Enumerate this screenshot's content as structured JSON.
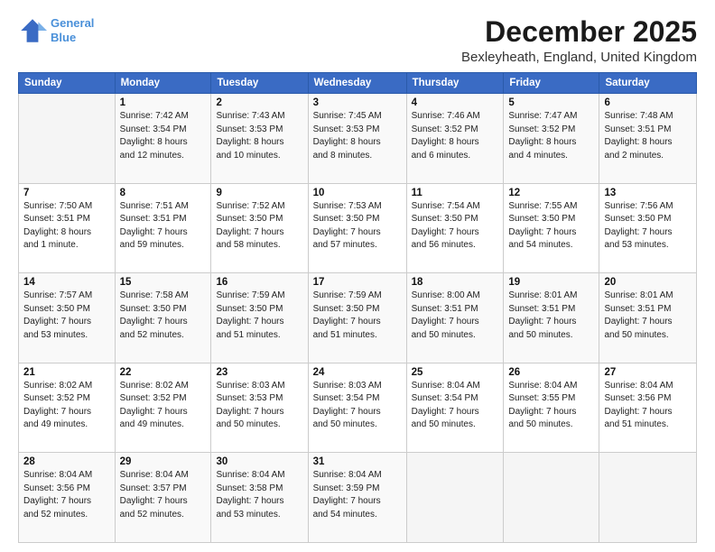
{
  "logo": {
    "line1": "General",
    "line2": "Blue"
  },
  "title": "December 2025",
  "location": "Bexleyheath, England, United Kingdom",
  "weekdays": [
    "Sunday",
    "Monday",
    "Tuesday",
    "Wednesday",
    "Thursday",
    "Friday",
    "Saturday"
  ],
  "weeks": [
    [
      {
        "day": "",
        "info": ""
      },
      {
        "day": "1",
        "info": "Sunrise: 7:42 AM\nSunset: 3:54 PM\nDaylight: 8 hours\nand 12 minutes."
      },
      {
        "day": "2",
        "info": "Sunrise: 7:43 AM\nSunset: 3:53 PM\nDaylight: 8 hours\nand 10 minutes."
      },
      {
        "day": "3",
        "info": "Sunrise: 7:45 AM\nSunset: 3:53 PM\nDaylight: 8 hours\nand 8 minutes."
      },
      {
        "day": "4",
        "info": "Sunrise: 7:46 AM\nSunset: 3:52 PM\nDaylight: 8 hours\nand 6 minutes."
      },
      {
        "day": "5",
        "info": "Sunrise: 7:47 AM\nSunset: 3:52 PM\nDaylight: 8 hours\nand 4 minutes."
      },
      {
        "day": "6",
        "info": "Sunrise: 7:48 AM\nSunset: 3:51 PM\nDaylight: 8 hours\nand 2 minutes."
      }
    ],
    [
      {
        "day": "7",
        "info": "Sunrise: 7:50 AM\nSunset: 3:51 PM\nDaylight: 8 hours\nand 1 minute."
      },
      {
        "day": "8",
        "info": "Sunrise: 7:51 AM\nSunset: 3:51 PM\nDaylight: 7 hours\nand 59 minutes."
      },
      {
        "day": "9",
        "info": "Sunrise: 7:52 AM\nSunset: 3:50 PM\nDaylight: 7 hours\nand 58 minutes."
      },
      {
        "day": "10",
        "info": "Sunrise: 7:53 AM\nSunset: 3:50 PM\nDaylight: 7 hours\nand 57 minutes."
      },
      {
        "day": "11",
        "info": "Sunrise: 7:54 AM\nSunset: 3:50 PM\nDaylight: 7 hours\nand 56 minutes."
      },
      {
        "day": "12",
        "info": "Sunrise: 7:55 AM\nSunset: 3:50 PM\nDaylight: 7 hours\nand 54 minutes."
      },
      {
        "day": "13",
        "info": "Sunrise: 7:56 AM\nSunset: 3:50 PM\nDaylight: 7 hours\nand 53 minutes."
      }
    ],
    [
      {
        "day": "14",
        "info": "Sunrise: 7:57 AM\nSunset: 3:50 PM\nDaylight: 7 hours\nand 53 minutes."
      },
      {
        "day": "15",
        "info": "Sunrise: 7:58 AM\nSunset: 3:50 PM\nDaylight: 7 hours\nand 52 minutes."
      },
      {
        "day": "16",
        "info": "Sunrise: 7:59 AM\nSunset: 3:50 PM\nDaylight: 7 hours\nand 51 minutes."
      },
      {
        "day": "17",
        "info": "Sunrise: 7:59 AM\nSunset: 3:50 PM\nDaylight: 7 hours\nand 51 minutes."
      },
      {
        "day": "18",
        "info": "Sunrise: 8:00 AM\nSunset: 3:51 PM\nDaylight: 7 hours\nand 50 minutes."
      },
      {
        "day": "19",
        "info": "Sunrise: 8:01 AM\nSunset: 3:51 PM\nDaylight: 7 hours\nand 50 minutes."
      },
      {
        "day": "20",
        "info": "Sunrise: 8:01 AM\nSunset: 3:51 PM\nDaylight: 7 hours\nand 50 minutes."
      }
    ],
    [
      {
        "day": "21",
        "info": "Sunrise: 8:02 AM\nSunset: 3:52 PM\nDaylight: 7 hours\nand 49 minutes."
      },
      {
        "day": "22",
        "info": "Sunrise: 8:02 AM\nSunset: 3:52 PM\nDaylight: 7 hours\nand 49 minutes."
      },
      {
        "day": "23",
        "info": "Sunrise: 8:03 AM\nSunset: 3:53 PM\nDaylight: 7 hours\nand 50 minutes."
      },
      {
        "day": "24",
        "info": "Sunrise: 8:03 AM\nSunset: 3:54 PM\nDaylight: 7 hours\nand 50 minutes."
      },
      {
        "day": "25",
        "info": "Sunrise: 8:04 AM\nSunset: 3:54 PM\nDaylight: 7 hours\nand 50 minutes."
      },
      {
        "day": "26",
        "info": "Sunrise: 8:04 AM\nSunset: 3:55 PM\nDaylight: 7 hours\nand 50 minutes."
      },
      {
        "day": "27",
        "info": "Sunrise: 8:04 AM\nSunset: 3:56 PM\nDaylight: 7 hours\nand 51 minutes."
      }
    ],
    [
      {
        "day": "28",
        "info": "Sunrise: 8:04 AM\nSunset: 3:56 PM\nDaylight: 7 hours\nand 52 minutes."
      },
      {
        "day": "29",
        "info": "Sunrise: 8:04 AM\nSunset: 3:57 PM\nDaylight: 7 hours\nand 52 minutes."
      },
      {
        "day": "30",
        "info": "Sunrise: 8:04 AM\nSunset: 3:58 PM\nDaylight: 7 hours\nand 53 minutes."
      },
      {
        "day": "31",
        "info": "Sunrise: 8:04 AM\nSunset: 3:59 PM\nDaylight: 7 hours\nand 54 minutes."
      },
      {
        "day": "",
        "info": ""
      },
      {
        "day": "",
        "info": ""
      },
      {
        "day": "",
        "info": ""
      }
    ]
  ]
}
